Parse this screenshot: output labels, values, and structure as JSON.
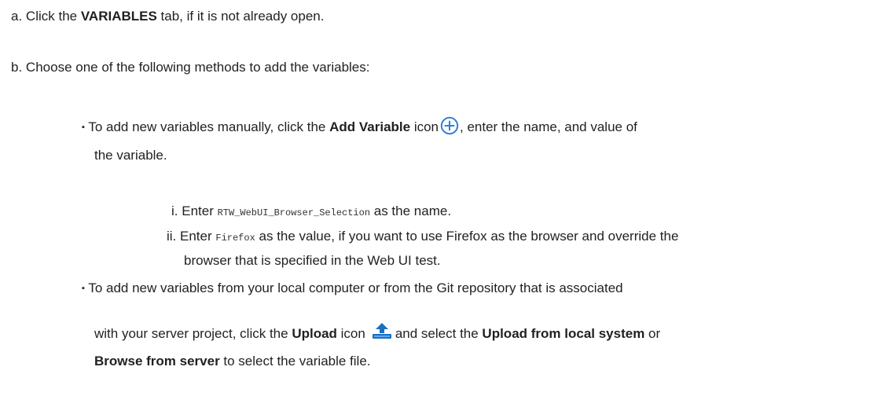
{
  "step_a": {
    "marker": "a.",
    "pre": "Click the ",
    "bold": "VARIABLES",
    "post": " tab, if it is not already open."
  },
  "step_b": {
    "marker": "b.",
    "text": "Choose one of the following methods to add the variables:"
  },
  "bullet1": {
    "marker": "▪",
    "pre": "To add new variables manually, click the ",
    "bold": "Add Variable",
    "mid": " icon",
    "post": ", enter the name, and value of",
    "line2": "the variable.",
    "icon": "add-circle-icon",
    "icon_color": "#2f7fd9"
  },
  "sub_i": {
    "marker": "i.",
    "pre": "Enter ",
    "code": "RTW_WebUI_Browser_Selection",
    "post": " as the name."
  },
  "sub_ii": {
    "marker": "ii.",
    "pre": "Enter ",
    "code": "Firefox",
    "post": " as the value, if you want to use Firefox as the browser and override the",
    "line2": "browser that is specified in the Web UI test."
  },
  "bullet2": {
    "marker": "▪",
    "line1": "To add new variables from your local computer or from the Git repository that is associated",
    "pre": "with your server project, click the ",
    "bold1": "Upload",
    "mid1": " icon",
    "mid2": "and select the ",
    "bold2": "Upload from local system",
    "mid3": " or",
    "bold3": "Browse from server",
    "post": " to select the variable file.",
    "icon": "upload-icon",
    "icon_color": "#1a6fc4"
  }
}
